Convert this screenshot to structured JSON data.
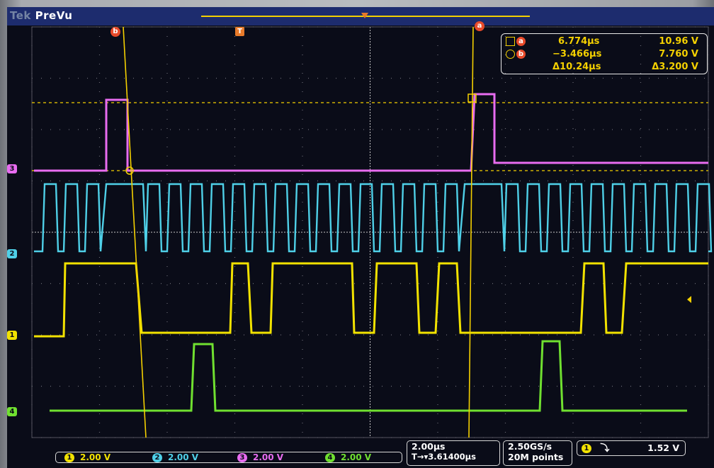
{
  "topbar": {
    "brand": "Tek",
    "mode": "PreVu"
  },
  "cursors": {
    "a_label": "a",
    "b_label": "b",
    "trigger_label": "T",
    "a": {
      "time": "6.774µs",
      "volts": "10.96 V"
    },
    "b": {
      "time": "−3.466µs",
      "volts": "7.760 V"
    },
    "delta": {
      "time": "Δ10.24µs",
      "volts": "Δ3.200 V"
    }
  },
  "channels": [
    {
      "id": "1",
      "scale": "2.00 V",
      "color": "#f2e200"
    },
    {
      "id": "2",
      "scale": "2.00 V",
      "color": "#4fd0e8"
    },
    {
      "id": "3",
      "scale": "2.00 V",
      "color": "#e86cf0"
    },
    {
      "id": "4",
      "scale": "2.00 V",
      "color": "#70e030"
    }
  ],
  "horizontal": {
    "timebase": "2.00µs",
    "trigger_pos": "T→▾3.61400µs"
  },
  "acquisition": {
    "rate": "2.50GS/s",
    "points": "20M points"
  },
  "trigger": {
    "source": "1",
    "slope": "falling-edge-icon",
    "level": "1.52 V"
  },
  "colors": {
    "ch1": "#f2e200",
    "ch2": "#4fd0e8",
    "ch3": "#e86cf0",
    "ch4": "#70e030",
    "cursor": "#f4d000",
    "badge": "#e84a2a"
  }
}
